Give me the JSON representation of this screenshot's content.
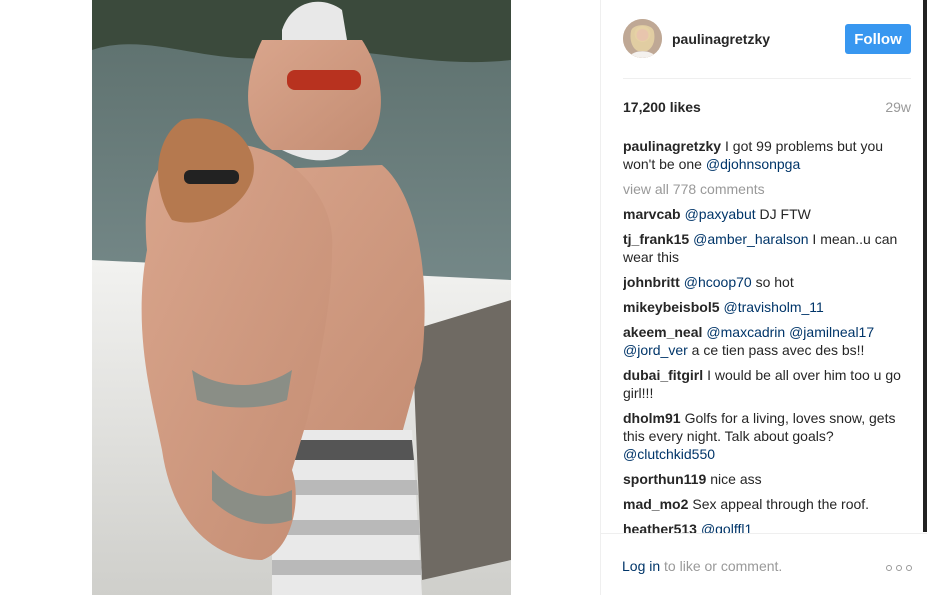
{
  "post": {
    "username": "paulinagretzky",
    "follow_label": "Follow",
    "likes": "17,200 likes",
    "age": "29w",
    "caption": {
      "user": "paulinagretzky",
      "text": "I got 99 problems but you won't be one ",
      "mention": "@djohnsonpga"
    },
    "view_all": "view all 778 comments"
  },
  "comments": [
    {
      "user": "marvcab",
      "m1": "@paxyabut",
      "t1": " DJ FTW",
      "m2": "",
      "t2": "",
      "m3": "",
      "t3": ""
    },
    {
      "user": "tj_frank15",
      "m1": "@amber_haralson",
      "t1": " I mean..u can wear this",
      "m2": "",
      "t2": "",
      "m3": "",
      "t3": ""
    },
    {
      "user": "johnbritt",
      "m1": "@hcoop70",
      "t1": " so hot",
      "m2": "",
      "t2": "",
      "m3": "",
      "t3": ""
    },
    {
      "user": "mikeybeisbol5",
      "m1": "@travisholm_11",
      "t1": "",
      "m2": "",
      "t2": "",
      "m3": "",
      "t3": ""
    },
    {
      "user": "akeem_neal",
      "m1": "@maxcadrin",
      "t1": " ",
      "m2": "@jamilneal17",
      "t2": " ",
      "m3": "@jord_ver",
      "t3": " a ce tien pass avec des bs!!"
    },
    {
      "user": "dubai_fitgirl",
      "m1": "",
      "t1": "I would be all over him too u go girl!!!",
      "m2": "",
      "t2": "",
      "m3": "",
      "t3": ""
    },
    {
      "user": "dholm91",
      "m1": "",
      "t1": "Golfs for a living, loves snow, gets this every night. Talk about goals? ",
      "m2": "@clutchkid550",
      "t2": "",
      "m3": "",
      "t3": ""
    },
    {
      "user": "sporthun119",
      "m1": "",
      "t1": "nice ass",
      "m2": "",
      "t2": "",
      "m3": "",
      "t3": ""
    },
    {
      "user": "mad_mo2",
      "m1": "",
      "t1": "Sex appeal through the roof.",
      "m2": "",
      "t2": "",
      "m3": "",
      "t3": ""
    },
    {
      "user": "heather513",
      "m1": "@golffl1",
      "t1": "",
      "m2": "",
      "t2": "",
      "m3": "",
      "t3": ""
    }
  ],
  "footer": {
    "login": "Log in",
    "text": " to like or comment."
  },
  "icons": {
    "more": "more-options-icon",
    "avatar": "profile-avatar"
  },
  "colors": {
    "follow_button": "#3897f0",
    "mention": "#003569",
    "muted": "#999999",
    "text": "#262626"
  }
}
